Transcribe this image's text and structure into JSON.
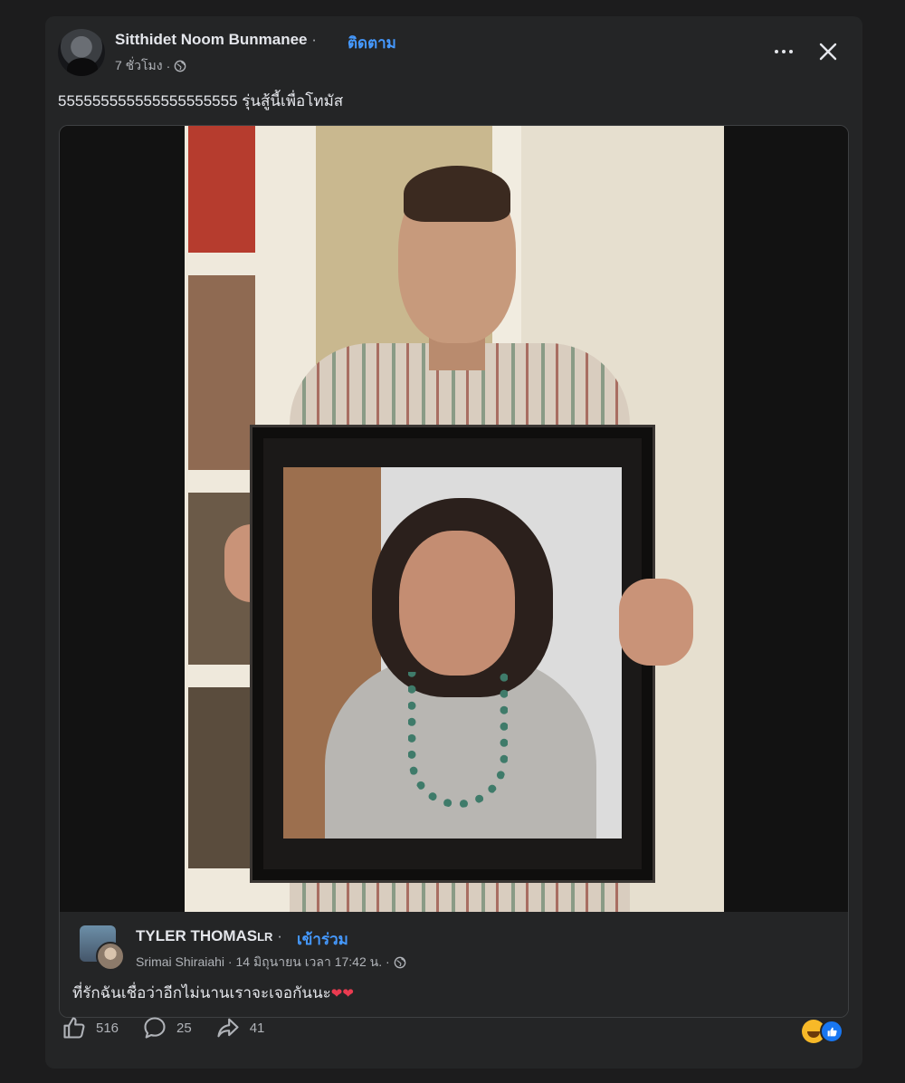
{
  "post": {
    "author": "Sitthidet Noom Bunmanee",
    "separator": "·",
    "follow_label": "ติดตาม",
    "time": "7 ชั่วโมง",
    "audience_icon": "globe-icon",
    "text": "555555555555555555555 รุ่นสู้นี้เพื่อโทมัส"
  },
  "shared_post": {
    "author": "TYLER THOMAS",
    "author_suffix": "LR",
    "separator": "·",
    "join_label": "เข้าร่วม",
    "meta": "Srimai Shiraiahi · 14 มิถุนายน เวลา 17:42 น. ·",
    "text": "ที่รักฉันเชื่อว่าอีกไม่นานเราจะเจอกันนะ",
    "emojis": "❤❤"
  },
  "actions": {
    "like_count": "516",
    "comment_count": "25",
    "share_count": "41"
  },
  "reactions": [
    "haha",
    "like"
  ],
  "colors": {
    "background": "#1c1c1d",
    "card": "#242526",
    "link_blue": "#4599ff",
    "text_primary": "#e4e6eb",
    "text_secondary": "#b0b3b8"
  }
}
